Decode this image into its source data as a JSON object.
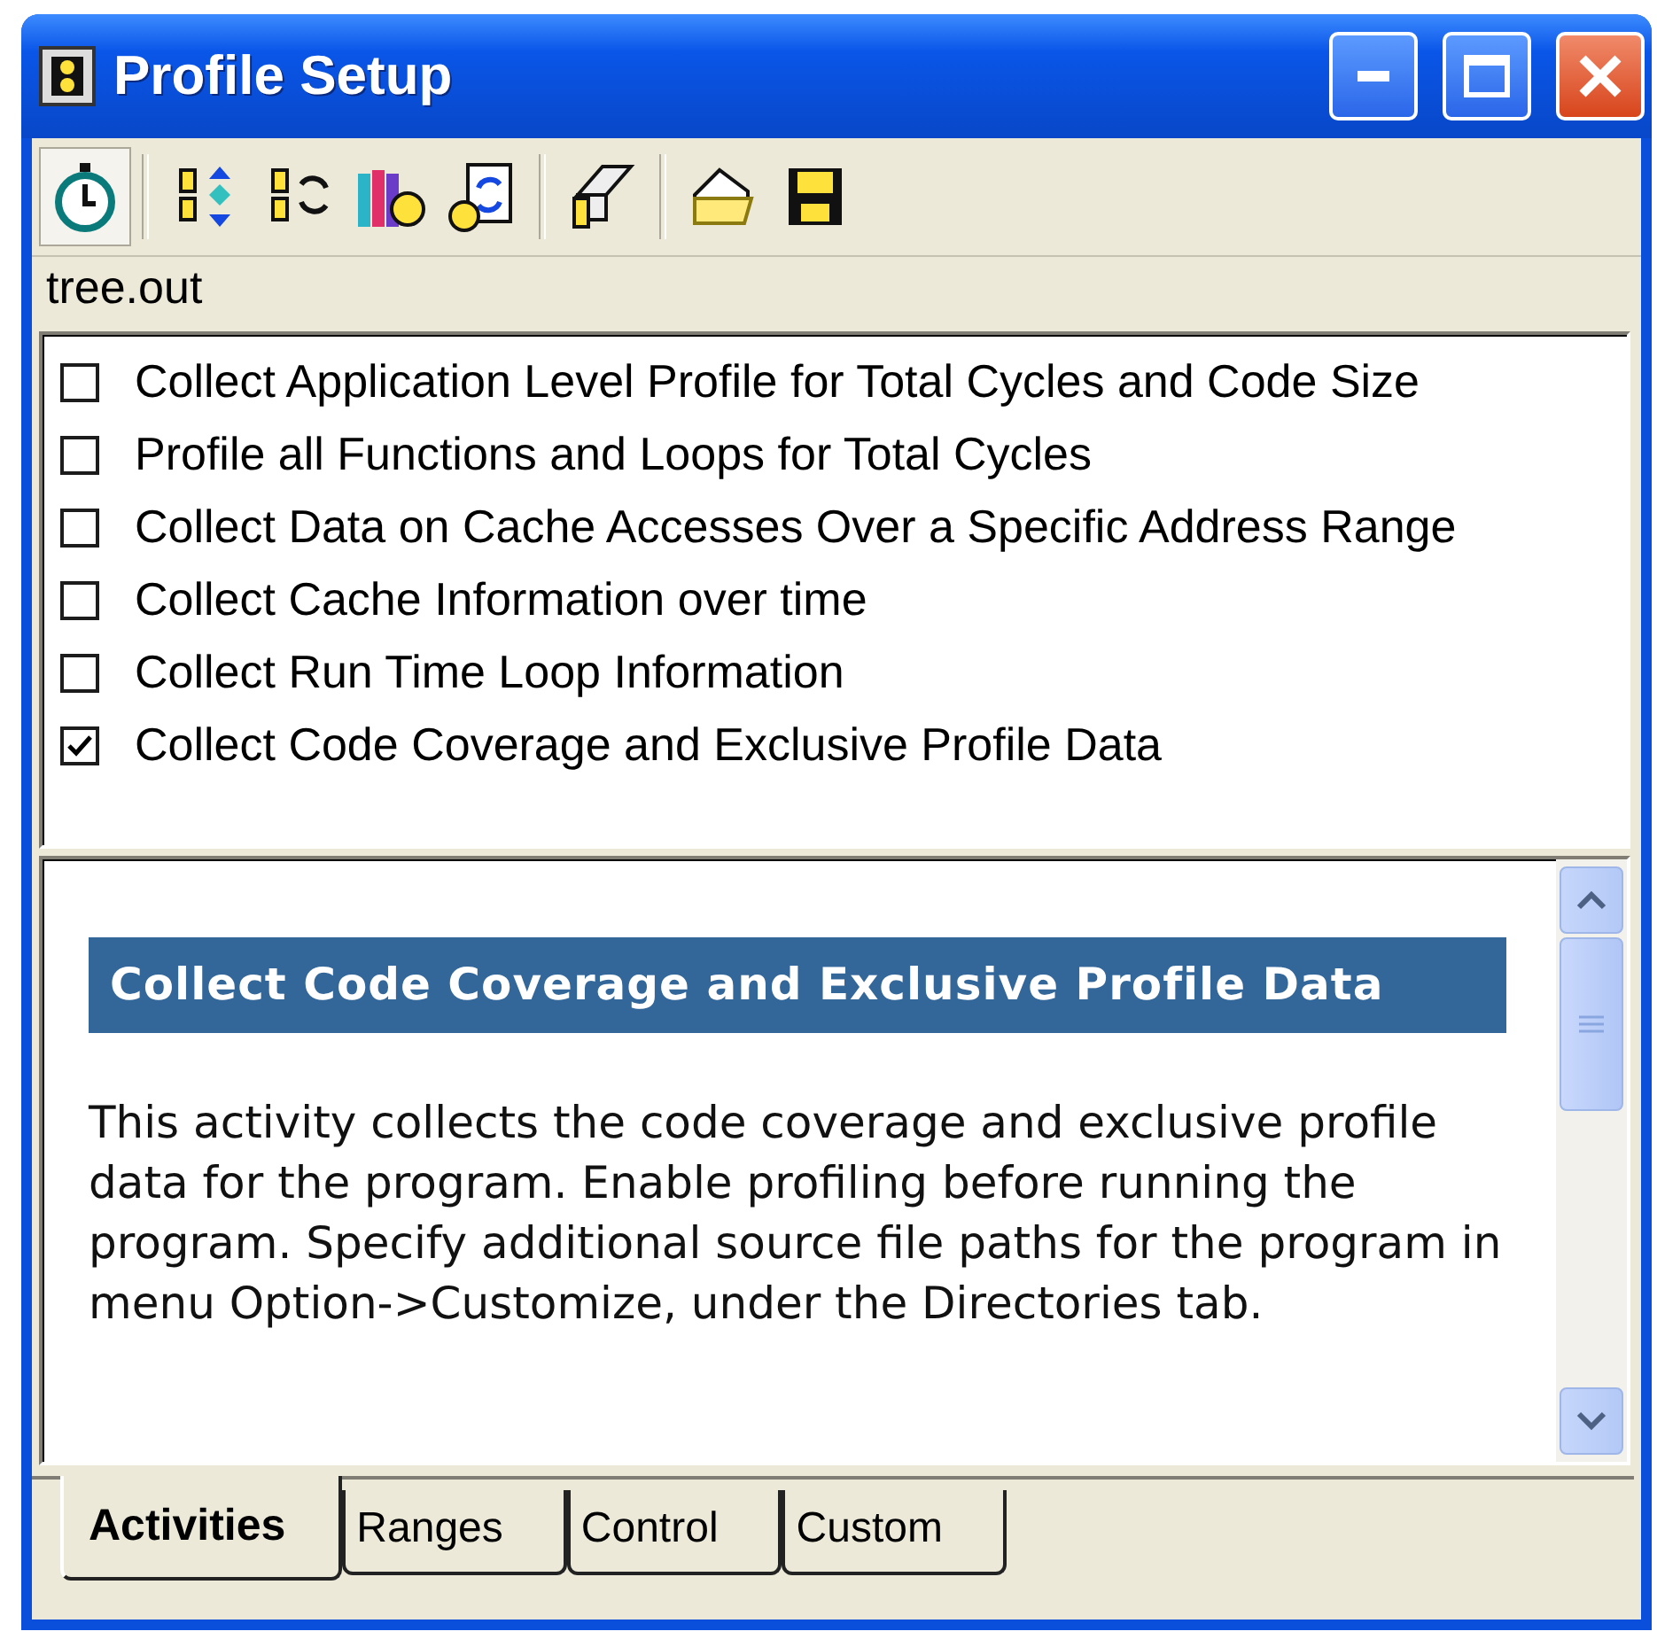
{
  "window": {
    "title": "Profile Setup"
  },
  "toolbar": [
    {
      "buttons": [
        {
          "pressed": true
        }
      ]
    },
    {
      "buttons": [
        {
          "pressed": false
        },
        {
          "pressed": false
        },
        {
          "pressed": false
        },
        {
          "pressed": false
        }
      ]
    },
    {
      "buttons": [
        {
          "pressed": false
        }
      ]
    },
    {
      "buttons": [
        {
          "pressed": false
        },
        {
          "pressed": false
        }
      ]
    }
  ],
  "file_label": "tree.out",
  "activities": [
    {
      "label": "Collect Application Level Profile for Total Cycles and Code Size",
      "checked": false
    },
    {
      "label": "Profile all Functions and Loops for Total Cycles",
      "checked": false
    },
    {
      "label": "Collect Data on Cache Accesses Over a Specific Address Range",
      "checked": false
    },
    {
      "label": "Collect Cache Information over time",
      "checked": false
    },
    {
      "label": "Collect Run Time Loop Information",
      "checked": false
    },
    {
      "label": "Collect Code Coverage and Exclusive Profile Data",
      "checked": true
    }
  ],
  "description": {
    "heading": "Collect Code Coverage and Exclusive Profile Data",
    "body": "This activity collects the code coverage and exclusive profile data for the program. Enable profiling before running the program. Specify additional source file paths for the program in menu Option->Customize, under the Directories tab."
  },
  "tabs": [
    {
      "label": "Activities",
      "selected": true
    },
    {
      "label": "Ranges",
      "selected": false
    },
    {
      "label": "Control",
      "selected": false
    },
    {
      "label": "Custom",
      "selected": false
    }
  ]
}
